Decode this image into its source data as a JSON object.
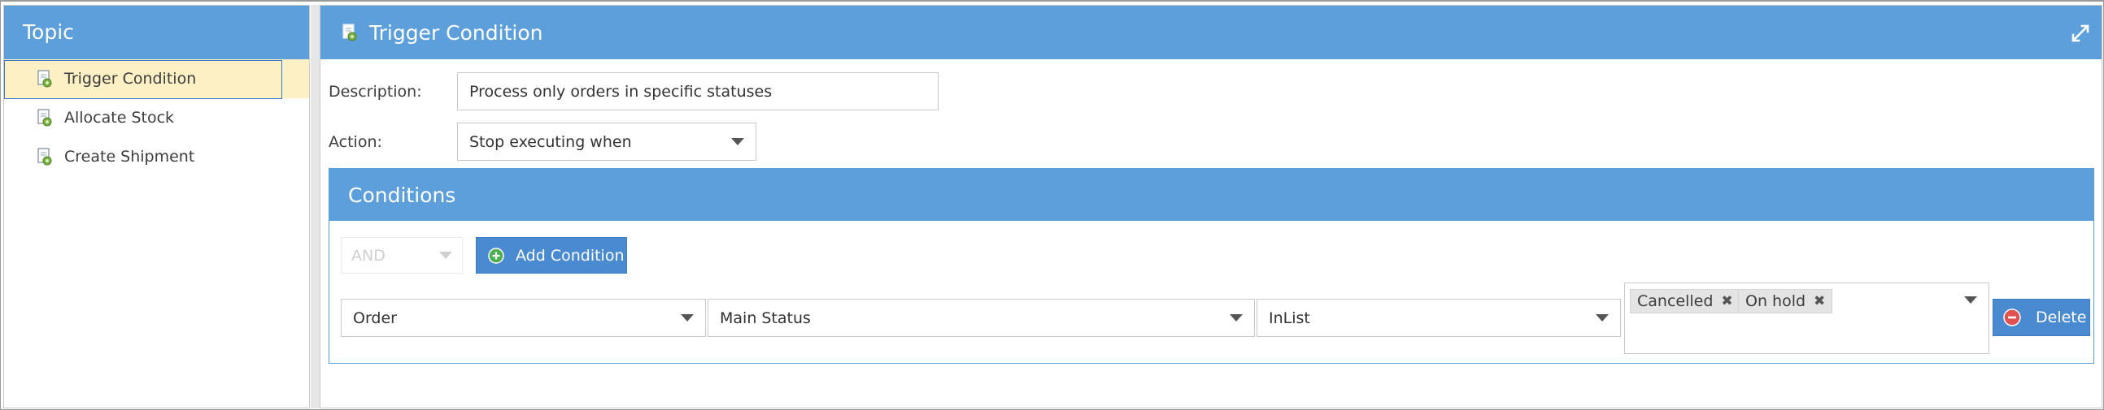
{
  "left_panel": {
    "title": "Topic",
    "items": [
      {
        "label": "Trigger Condition",
        "selected": true
      },
      {
        "label": "Allocate Stock",
        "selected": false
      },
      {
        "label": "Create Shipment",
        "selected": false
      }
    ]
  },
  "main": {
    "title": "Trigger Condition",
    "description_label": "Description:",
    "description_value": "Process only orders in specific statuses",
    "action_label": "Action:",
    "action_value": "Stop executing when",
    "conditions": {
      "title": "Conditions",
      "operator": "AND",
      "add_label": "Add Condition",
      "row": {
        "entity": "Order",
        "field": "Main Status",
        "comparison": "InList",
        "values": [
          "Cancelled",
          "On hold"
        ],
        "remove_symbol": "✖",
        "delete_label": "Delete"
      }
    }
  },
  "icons": {
    "topic_item": "document-gear-icon",
    "expand": "expand-icon",
    "add": "plus-circle-icon",
    "delete": "minus-circle-icon"
  },
  "colors": {
    "header_blue": "#5d9fdb",
    "button_blue": "#4a8ad1",
    "selected_row": "#fdf0c4",
    "add_icon_green": "#4caf50",
    "delete_icon_red": "#e05252"
  }
}
